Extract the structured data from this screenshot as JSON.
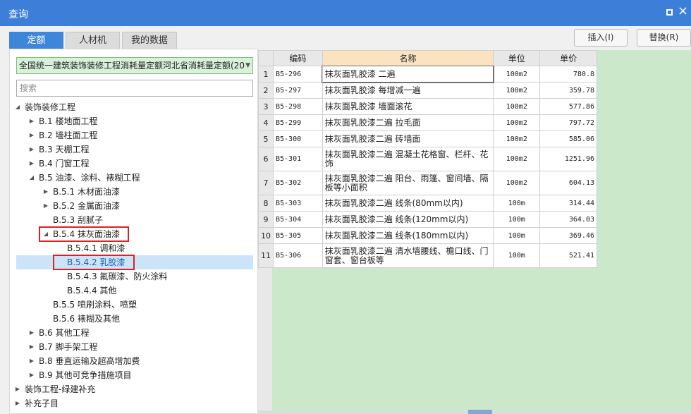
{
  "window": {
    "title": "查询"
  },
  "tabs": [
    {
      "label": "定额",
      "active": true
    },
    {
      "label": "人材机",
      "active": false
    },
    {
      "label": "我的数据",
      "active": false
    }
  ],
  "buttons": {
    "insert": "插入(I)",
    "replace": "替换(R)"
  },
  "left": {
    "quota_library": "全国统一建筑装饰装修工程消耗量定额河北省消耗量定额(20",
    "search_placeholder": "搜索"
  },
  "tree": [
    {
      "label": "装饰装修工程",
      "level": 0,
      "state": "expanded"
    },
    {
      "label": "B.1 楼地面工程",
      "level": 1,
      "state": "collapsed"
    },
    {
      "label": "B.2 墙柱面工程",
      "level": 1,
      "state": "collapsed"
    },
    {
      "label": "B.3 天棚工程",
      "level": 1,
      "state": "collapsed"
    },
    {
      "label": "B.4 门窗工程",
      "level": 1,
      "state": "collapsed"
    },
    {
      "label": "B.5 油漆、涂料、裱糊工程",
      "level": 1,
      "state": "expanded"
    },
    {
      "label": "B.5.1 木材面油漆",
      "level": 2,
      "state": "collapsed"
    },
    {
      "label": "B.5.2 金属面油漆",
      "level": 2,
      "state": "collapsed"
    },
    {
      "label": "B.5.3 刮腻子",
      "level": 2,
      "state": "leaf"
    },
    {
      "label": "B.5.4 抹灰面油漆",
      "level": 2,
      "state": "expanded",
      "highlighted": true
    },
    {
      "label": "B.5.4.1 调和漆",
      "level": 3,
      "state": "leaf"
    },
    {
      "label": "B.5.4.2 乳胶漆",
      "level": 3,
      "state": "leaf",
      "selected": true,
      "highlighted": true
    },
    {
      "label": "B.5.4.3 氟碳漆、防火涂料",
      "level": 3,
      "state": "leaf"
    },
    {
      "label": "B.5.4.4 其他",
      "level": 3,
      "state": "leaf"
    },
    {
      "label": "B.5.5 喷刷涂料、喷塑",
      "level": 2,
      "state": "leaf"
    },
    {
      "label": "B.5.6 裱糊及其他",
      "level": 2,
      "state": "leaf"
    },
    {
      "label": "B.6 其他工程",
      "level": 1,
      "state": "collapsed"
    },
    {
      "label": "B.7 脚手架工程",
      "level": 1,
      "state": "collapsed"
    },
    {
      "label": "B.8 垂直运输及超高增加费",
      "level": 1,
      "state": "collapsed"
    },
    {
      "label": "B.9 其他可竞争措施项目",
      "level": 1,
      "state": "collapsed"
    },
    {
      "label": "装饰工程-绿建补充",
      "level": 0,
      "state": "collapsed"
    },
    {
      "label": "补充子目",
      "level": 0,
      "state": "collapsed"
    }
  ],
  "grid": {
    "columns": [
      "编码",
      "名称",
      "单位",
      "单价"
    ],
    "rows": [
      {
        "n": "1",
        "code": "B5-296",
        "name": "抹灰面乳胶漆 二遍",
        "unit": "100m2",
        "price": "780.8"
      },
      {
        "n": "2",
        "code": "B5-297",
        "name": "抹灰面乳胶漆 每增减一遍",
        "unit": "100m2",
        "price": "359.78"
      },
      {
        "n": "3",
        "code": "B5-298",
        "name": "抹灰面乳胶漆 墙面滚花",
        "unit": "100m2",
        "price": "577.86"
      },
      {
        "n": "4",
        "code": "B5-299",
        "name": "抹灰面乳胶漆二遍 拉毛面",
        "unit": "100m2",
        "price": "797.72"
      },
      {
        "n": "5",
        "code": "B5-300",
        "name": "抹灰面乳胶漆二遍 砖墙面",
        "unit": "100m2",
        "price": "585.06"
      },
      {
        "n": "6",
        "code": "B5-301",
        "name": "抹灰面乳胶漆二遍 混凝土花格窗、栏杆、花饰",
        "unit": "100m2",
        "price": "1251.96"
      },
      {
        "n": "7",
        "code": "B5-302",
        "name": "抹灰面乳胶漆二遍 阳台、雨篷、窗间墙、隔板等小面积",
        "unit": "100m2",
        "price": "604.13"
      },
      {
        "n": "8",
        "code": "B5-303",
        "name": "抹灰面乳胶漆二遍 线条(80mm以内)",
        "unit": "100m",
        "price": "314.44"
      },
      {
        "n": "9",
        "code": "B5-304",
        "name": "抹灰面乳胶漆二遍 线条(120mm以内)",
        "unit": "100m",
        "price": "364.03"
      },
      {
        "n": "10",
        "code": "B5-305",
        "name": "抹灰面乳胶漆二遍 线条(180mm以内)",
        "unit": "100m",
        "price": "369.46"
      },
      {
        "n": "11",
        "code": "B5-306",
        "name": "抹灰面乳胶漆二遍 清水墙腰线、檐口线、门窗套、窗台板等",
        "unit": "100m",
        "price": "521.41"
      }
    ]
  },
  "colors": {
    "title_bar": "#3d7ed8",
    "active_tab": "#3d86d9",
    "selected_row": "#cce4f7",
    "green_area": "#cbe8cb",
    "highlight_box": "#e02020"
  }
}
